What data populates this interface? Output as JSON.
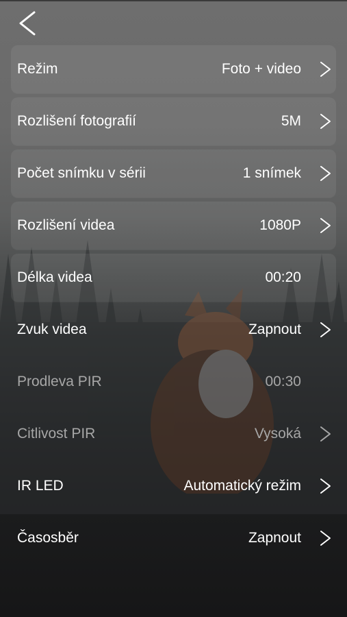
{
  "header": {
    "back_icon": "chevron-left-icon"
  },
  "settings": [
    {
      "label": "Režim",
      "value": "Foto + video",
      "chevron": true,
      "enabled": true
    },
    {
      "label": "Rozlišení fotografií",
      "value": "5M",
      "chevron": true,
      "enabled": true
    },
    {
      "label": "Počet snímku v sérii",
      "value": "1 snímek",
      "chevron": true,
      "enabled": true
    },
    {
      "label": "Rozlišení videa",
      "value": "1080P",
      "chevron": true,
      "enabled": true
    },
    {
      "label": "Délka videa",
      "value": "00:20",
      "chevron": false,
      "enabled": true
    },
    {
      "label": "Zvuk videa",
      "value": "Zapnout",
      "chevron": true,
      "enabled": true
    },
    {
      "label": "Prodleva PIR",
      "value": "00:30",
      "chevron": false,
      "enabled": false
    },
    {
      "label": "Citlivost PIR",
      "value": "Vysoká",
      "chevron": true,
      "enabled": false
    },
    {
      "label": "IR LED",
      "value": "Automatický režim",
      "chevron": true,
      "enabled": true
    },
    {
      "label": "Časosběr",
      "value": "Zapnout",
      "chevron": true,
      "enabled": true
    }
  ],
  "colors": {
    "text": "#ffffff",
    "disabled_text": "#a7a7a7"
  }
}
